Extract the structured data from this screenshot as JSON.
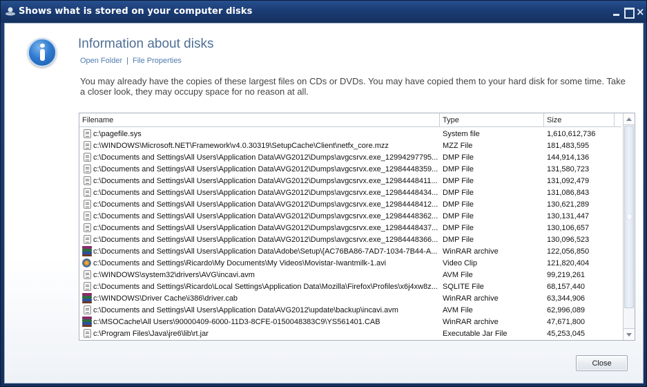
{
  "window": {
    "title": "Shows what is stored on your computer disks",
    "controls": {
      "minimize": "minimize",
      "maximize": "maximize",
      "close": "×"
    }
  },
  "header": {
    "heading": "Information about disks",
    "links": [
      "Open Folder",
      "File Properties"
    ],
    "separator": "|"
  },
  "description": "You may already have the copies of these largest files on CDs or DVDs. You may have copied them to your hard disk for some time. Take a closer look, they may occupy space for no reason at all.",
  "files": {
    "columns": [
      "Filename",
      "Type",
      "Size"
    ],
    "rows": [
      {
        "icon": "document-icon",
        "name": "c:\\pagefile.sys",
        "type": "System file",
        "size": "1,610,612,736"
      },
      {
        "icon": "document-icon",
        "name": "c:\\WINDOWS\\Microsoft.NET\\Framework\\v4.0.30319\\SetupCache\\Client\\netfx_core.mzz",
        "type": "MZZ File",
        "size": "181,483,595"
      },
      {
        "icon": "document-icon",
        "name": "c:\\Documents and Settings\\All Users\\Application Data\\AVG2012\\Dumps\\avgcsrvx.exe_12994297795...",
        "type": "DMP File",
        "size": "144,914,136"
      },
      {
        "icon": "document-icon",
        "name": "c:\\Documents and Settings\\All Users\\Application Data\\AVG2012\\Dumps\\avgcsrvx.exe_12984448359...",
        "type": "DMP File",
        "size": "131,580,723"
      },
      {
        "icon": "document-icon",
        "name": "c:\\Documents and Settings\\All Users\\Application Data\\AVG2012\\Dumps\\avgcsrvx.exe_12984448411...",
        "type": "DMP File",
        "size": "131,092,479"
      },
      {
        "icon": "document-icon",
        "name": "c:\\Documents and Settings\\All Users\\Application Data\\AVG2012\\Dumps\\avgcsrvx.exe_12984448434...",
        "type": "DMP File",
        "size": "131,086,843"
      },
      {
        "icon": "document-icon",
        "name": "c:\\Documents and Settings\\All Users\\Application Data\\AVG2012\\Dumps\\avgcsrvx.exe_12984448412...",
        "type": "DMP File",
        "size": "130,621,289"
      },
      {
        "icon": "document-icon",
        "name": "c:\\Documents and Settings\\All Users\\Application Data\\AVG2012\\Dumps\\avgcsrvx.exe_12984448362...",
        "type": "DMP File",
        "size": "130,131,447"
      },
      {
        "icon": "document-icon",
        "name": "c:\\Documents and Settings\\All Users\\Application Data\\AVG2012\\Dumps\\avgcsrvx.exe_12984448437...",
        "type": "DMP File",
        "size": "130,106,657"
      },
      {
        "icon": "document-icon",
        "name": "c:\\Documents and Settings\\All Users\\Application Data\\AVG2012\\Dumps\\avgcsrvx.exe_12984448366...",
        "type": "DMP File",
        "size": "130,096,523"
      },
      {
        "icon": "winrar-archive-icon",
        "name": "c:\\Documents and Settings\\All Users\\Application Data\\Adobe\\Setup\\{AC76BA86-7AD7-1034-7B44-A...",
        "type": "WinRAR archive",
        "size": "122,056,850"
      },
      {
        "icon": "video-clip-icon",
        "name": "c:\\Documents and Settings\\Ricardo\\My Documents\\My Videos\\Movistar-Iwantmilk-1.avi",
        "type": "Video Clip",
        "size": "121,820,404"
      },
      {
        "icon": "document-icon",
        "name": "c:\\WINDOWS\\system32\\drivers\\AVG\\incavi.avm",
        "type": "AVM File",
        "size": "99,219,261"
      },
      {
        "icon": "document-icon",
        "name": "c:\\Documents and Settings\\Ricardo\\Local Settings\\Application Data\\Mozilla\\Firefox\\Profiles\\x6j4xw8z...",
        "type": "SQLITE File",
        "size": "68,157,440"
      },
      {
        "icon": "winrar-archive-icon",
        "name": "c:\\WINDOWS\\Driver Cache\\i386\\driver.cab",
        "type": "WinRAR archive",
        "size": "63,344,906"
      },
      {
        "icon": "document-icon",
        "name": "c:\\Documents and Settings\\All Users\\Application Data\\AVG2012\\update\\backup\\incavi.avm",
        "type": "AVM File",
        "size": "62,996,089"
      },
      {
        "icon": "winrar-archive-icon",
        "name": "c:\\MSOCache\\All Users\\90000409-6000-11D3-8CFE-0150048383C9\\YS561401.CAB",
        "type": "WinRAR archive",
        "size": "47,671,800"
      },
      {
        "icon": "document-icon",
        "name": "c:\\Program Files\\Java\\jre6\\lib\\rt.jar",
        "type": "Executable Jar File",
        "size": "45,253,045"
      }
    ]
  },
  "footer": {
    "close_label": "Close"
  },
  "colors": {
    "titlebar": "#1b3c74",
    "heading": "#4f6f95",
    "link": "#4f7bae"
  }
}
